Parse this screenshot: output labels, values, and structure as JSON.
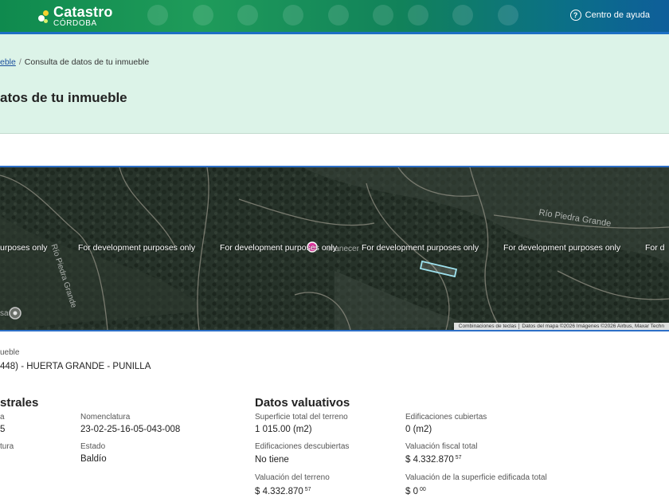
{
  "header": {
    "brand_title": "Catastro",
    "brand_subtitle": "CÓRDOBA",
    "help_label": "Centro de ayuda",
    "help_icon": "question-circle-icon",
    "colors": {
      "green": "#0f8a4e",
      "blue": "#0e5e9a",
      "accent_line": "#1d6fc4"
    }
  },
  "breadcrumb": {
    "parent": "eble",
    "current": "Consulta de datos de tu inmueble"
  },
  "page_title": "atos de tu inmueble",
  "map": {
    "watermark": "For development purposes only",
    "watermark_first": "urposes only",
    "watermark_last": "For d",
    "labels": {
      "rio_piedra_grande": "Río Piedra Grande",
      "rio_piedra_grande_vertical": "Río Piedra Grande",
      "place": "manecer",
      "small": "sa"
    },
    "attribution": {
      "shortcuts": "Combinaciones de teclas",
      "data": "Datos del mapa ©2026 Imágenes ©2026 Airbus, Maxar Techn"
    }
  },
  "property": {
    "label": "ueble",
    "address": "448) - HUERTA GRANDE - PUNILLA"
  },
  "catastral": {
    "title": "strales",
    "partial_label_1": "a",
    "partial_value_1": "5",
    "partial_label_2": "tura",
    "nomenclatura_label": "Nomenclatura",
    "nomenclatura_value": "23-02-25-16-05-043-008",
    "estado_label": "Estado",
    "estado_value": "Baldío"
  },
  "valuativos": {
    "title": "Datos valuativos",
    "superficie_terreno_label": "Superficie total del terreno",
    "superficie_terreno_value": "1 015.00 (m2)",
    "edif_cubiertas_label": "Edificaciones cubiertas",
    "edif_cubiertas_value": "0 (m2)",
    "edif_descubiertas_label": "Edificaciones descubiertas",
    "edif_descubiertas_value": "No tiene",
    "valuacion_fiscal_label": "Valuación fiscal total",
    "valuacion_fiscal_value": "$ 4.332.870",
    "valuacion_fiscal_cents": "57",
    "valuacion_terreno_label": "Valuación del terreno",
    "valuacion_terreno_value": "$ 4.332.870",
    "valuacion_terreno_cents": "57",
    "valuacion_edificada_label": "Valuación de la superficie edificada total",
    "valuacion_edificada_value": "$ 0",
    "valuacion_edificada_cents": "00"
  }
}
